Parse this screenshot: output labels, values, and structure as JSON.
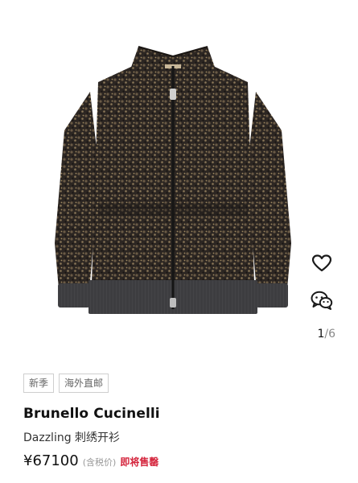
{
  "product": {
    "pager_current": "1",
    "pager_separator": "/",
    "pager_total": "6",
    "tags": [
      "新季",
      "海外直邮"
    ],
    "brand": "Brunello Cucinelli",
    "name": "Dazzling 刺绣开衫",
    "price": "¥67100",
    "tax_note": "(含税价)",
    "status": "即将售罄"
  },
  "icons": {
    "favorite": "heart-icon",
    "share": "wechat-icon"
  },
  "colors": {
    "status": "#d4233b",
    "garment_knit": "#3f3f42",
    "garment_sequin": "#2a2420"
  }
}
